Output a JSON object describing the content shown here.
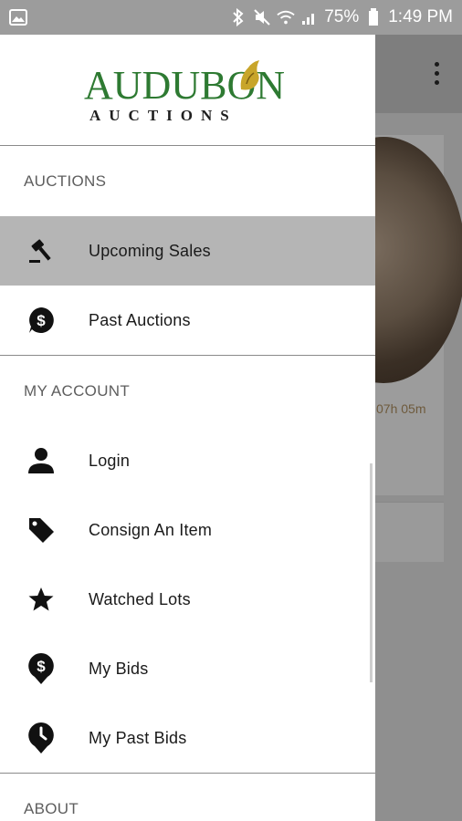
{
  "status_bar": {
    "battery": "75%",
    "time": "1:49 PM"
  },
  "background": {
    "timer_text": "07h 05m"
  },
  "logo": {
    "main_text": "AUDUBON",
    "sub_text": "AUCTIONS",
    "color": "#2e7a32"
  },
  "sections": {
    "auctions": "AUCTIONS",
    "my_account": "MY ACCOUNT",
    "about": "ABOUT"
  },
  "auctions_items": [
    {
      "label": "Upcoming Sales",
      "icon": "gavel-icon",
      "active": true
    },
    {
      "label": "Past Auctions",
      "icon": "dollar-bubble-icon",
      "active": false
    }
  ],
  "account_items": [
    {
      "label": "Login",
      "icon": "person-icon"
    },
    {
      "label": "Consign An Item",
      "icon": "tag-icon"
    },
    {
      "label": "Watched Lots",
      "icon": "star-icon"
    },
    {
      "label": "My Bids",
      "icon": "dollar-pin-icon"
    },
    {
      "label": "My Past Bids",
      "icon": "clock-pin-icon"
    }
  ],
  "colors": {
    "active_item_bg": "#b5b5b5",
    "scrim": "#8f8f8f"
  }
}
